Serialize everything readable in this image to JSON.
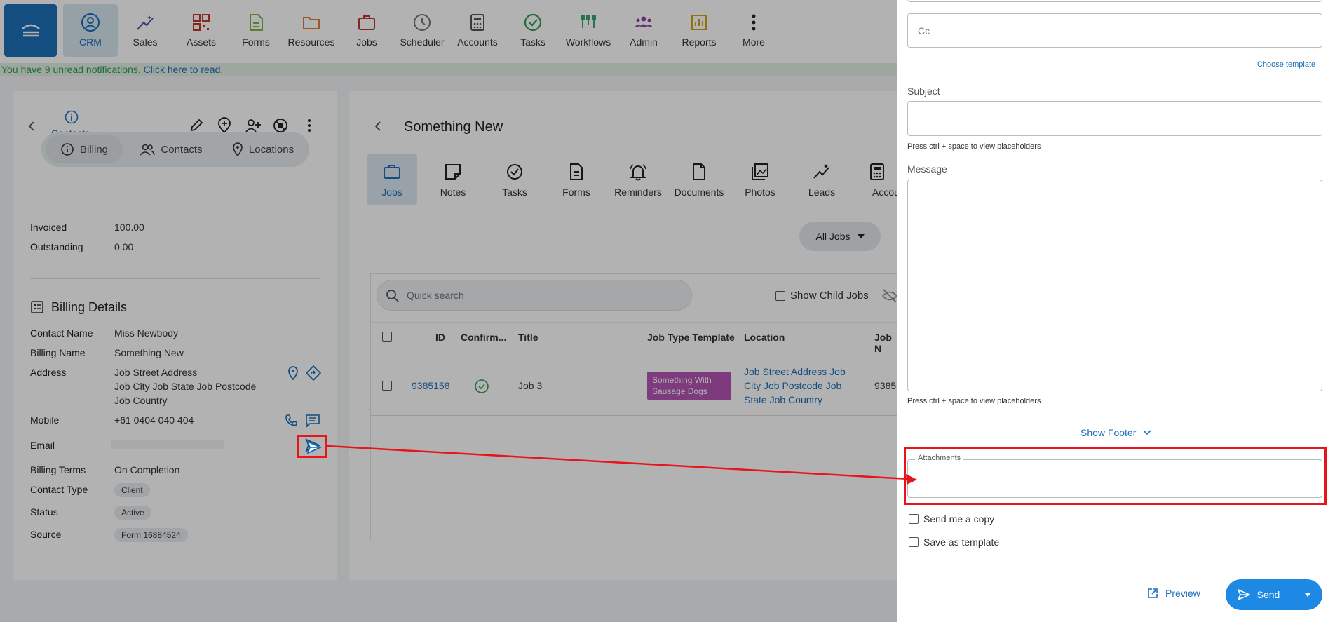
{
  "nav": {
    "items": [
      {
        "label": "CRM",
        "icon": "crm-icon",
        "color": "#1d6fb8"
      },
      {
        "label": "Sales",
        "icon": "sales-icon",
        "color": "#4a55a2"
      },
      {
        "label": "Assets",
        "icon": "assets-icon",
        "color": "#c0392b"
      },
      {
        "label": "Forms",
        "icon": "forms-icon",
        "color": "#7ab648"
      },
      {
        "label": "Resources",
        "icon": "resources-icon",
        "color": "#e07b39"
      },
      {
        "label": "Jobs",
        "icon": "jobs-icon",
        "color": "#c0392b"
      },
      {
        "label": "Scheduler",
        "icon": "scheduler-icon",
        "color": "#777"
      },
      {
        "label": "Accounts",
        "icon": "accounts-icon",
        "color": "#555"
      },
      {
        "label": "Tasks",
        "icon": "tasks-icon",
        "color": "#2e9c52"
      },
      {
        "label": "Workflows",
        "icon": "workflows-icon",
        "color": "#3aa372"
      },
      {
        "label": "Admin",
        "icon": "admin-icon",
        "color": "#8e44ad"
      },
      {
        "label": "Reports",
        "icon": "reports-icon",
        "color": "#d4a017"
      },
      {
        "label": "More",
        "icon": "more-icon",
        "color": "#222"
      }
    ]
  },
  "notification": {
    "text": "You have 9 unread notifications.",
    "link": "Click here to read."
  },
  "left": {
    "header_label": "Contacts",
    "segments": [
      "Billing",
      "Contacts",
      "Locations"
    ],
    "invoiced_label": "Invoiced",
    "invoiced_value": "100.00",
    "outstanding_label": "Outstanding",
    "outstanding_value": "0.00",
    "billing_details_title": "Billing Details",
    "rows": {
      "contact_name_label": "Contact Name",
      "contact_name": "Miss Newbody",
      "billing_name_label": "Billing Name",
      "billing_name": "Something New",
      "address_label": "Address",
      "address_line1": "Job Street Address",
      "address_line2": "Job City Job State Job Postcode",
      "address_line3": "Job Country",
      "mobile_label": "Mobile",
      "mobile": "+61 0404 040 404",
      "email_label": "Email",
      "billing_terms_label": "Billing Terms",
      "billing_terms": "On Completion",
      "contact_type_label": "Contact Type",
      "contact_type": "Client",
      "status_label": "Status",
      "status": "Active",
      "source_label": "Source",
      "source": "Form 16884524"
    }
  },
  "middle": {
    "title": "Something New",
    "tabs": [
      "Jobs",
      "Notes",
      "Tasks",
      "Forms",
      "Reminders",
      "Documents",
      "Photos",
      "Leads",
      "Accoun"
    ],
    "filter": "All Jobs",
    "search_placeholder": "Quick search",
    "show_child_jobs": "Show Child Jobs",
    "columns": [
      "ID",
      "Confirm...",
      "Title",
      "Job Type Template",
      "Location",
      "Job N"
    ],
    "row": {
      "id": "9385158",
      "title": "Job 3",
      "template": "Something With Sausage Dogs",
      "location_line1": "Job Street Address Job",
      "location_line2": "City Job Postcode Job",
      "location_line3": "State Job Country",
      "job_n": "9385"
    }
  },
  "drawer": {
    "cc_placeholder": "Cc",
    "choose_template": "Choose template",
    "subject_label": "Subject",
    "hint": "Press ctrl + space to view placeholders",
    "message_label": "Message",
    "show_footer": "Show Footer",
    "attachments_label": "Attachments",
    "send_copy": "Send me a copy",
    "save_template": "Save as template",
    "preview": "Preview",
    "send": "Send"
  },
  "colors": {
    "accent": "#1d6fb8",
    "highlight": "#e8141b",
    "send": "#1e88e5"
  }
}
